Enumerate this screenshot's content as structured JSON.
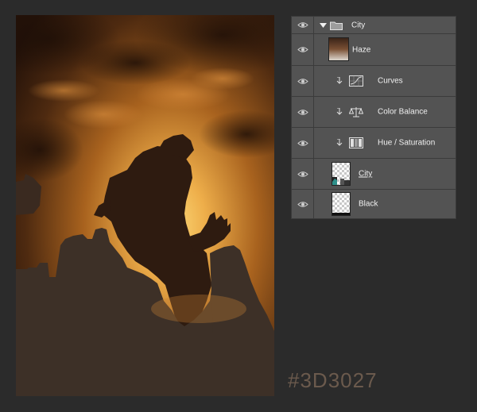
{
  "caption": {
    "color_code": "#3D3027"
  },
  "colors": {
    "panel_bg": "#535353",
    "row_divider": "#3b3b3b",
    "canvas_bg": "#2b2b2b",
    "ground_fill": "#3D3027"
  },
  "layers": {
    "group": {
      "name": "City",
      "icon": "folder-icon",
      "expanded": true,
      "visible": true
    },
    "items": [
      {
        "name": "Haze",
        "kind": "pixel",
        "visible": true
      },
      {
        "name": "Curves",
        "kind": "adjustment",
        "icon": "curves-icon",
        "clipped": true,
        "visible": true
      },
      {
        "name": "Color Balance",
        "kind": "adjustment",
        "icon": "color-balance-icon",
        "clipped": true,
        "visible": true
      },
      {
        "name": "Hue / Saturation",
        "kind": "adjustment",
        "icon": "hue-saturation-icon",
        "clipped": true,
        "visible": true
      },
      {
        "name": "City",
        "kind": "pixel-with-mask",
        "visible": true
      },
      {
        "name": "Black",
        "kind": "pixel",
        "visible": true
      }
    ]
  }
}
